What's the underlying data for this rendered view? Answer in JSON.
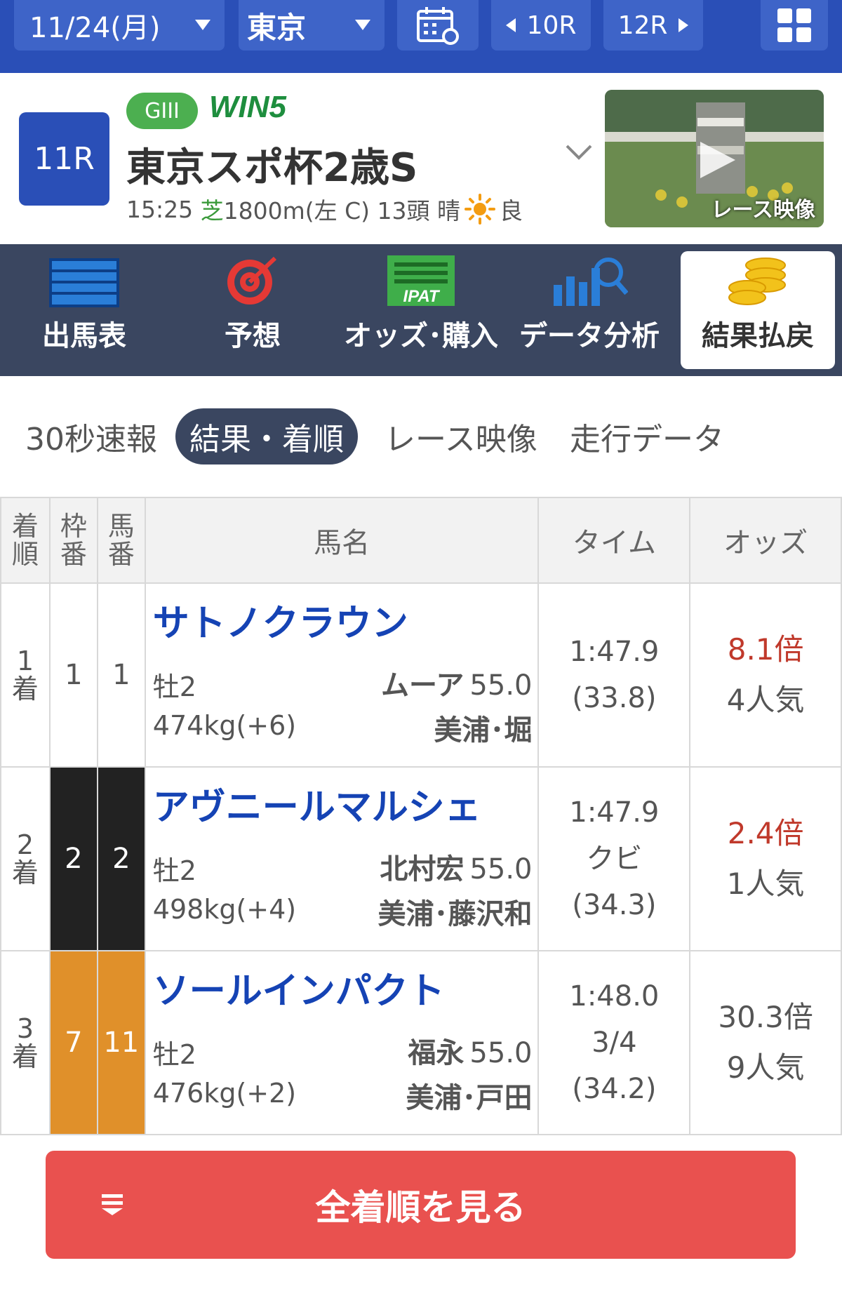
{
  "topbar": {
    "date": "11/24(月)",
    "venue": "東京",
    "prev_race": "10R",
    "next_race": "12R"
  },
  "race": {
    "number": "11R",
    "grade": "GIII",
    "win5_label": "WIN5",
    "title": "東京スポ杯2歳S",
    "time": "15:25",
    "surface": "芝",
    "distance": "1800m(左 C)",
    "runners": "13頭",
    "weather": "晴",
    "going": "良",
    "video_label": "レース映像"
  },
  "main_tabs": [
    "出馬表",
    "予想",
    "オッズ･購入",
    "データ分析",
    "結果払戻"
  ],
  "sub_tabs": [
    "30秒速報",
    "結果・着順",
    "レース映像",
    "走行データ"
  ],
  "table": {
    "headers": {
      "position": "着順",
      "frame": "枠番",
      "number": "馬番",
      "horse": "馬名",
      "time": "タイム",
      "odds": "オッズ"
    },
    "rows": [
      {
        "position": "1",
        "position_suffix": "着",
        "frame": "1",
        "number": "1",
        "frame_color": "#ffffff",
        "frame_text_color": "#555555",
        "horse": "サトノクラウン",
        "sex_age": "牡2",
        "jockey": "ムーア",
        "jockey_weight": "55.0",
        "weight": "474kg(+6)",
        "trainer": "美浦･堀",
        "time": "1:47.9",
        "margin": "",
        "last3f": "(33.8)",
        "odds": "8.1倍",
        "popularity": "4人気",
        "odds_highlight": true
      },
      {
        "position": "2",
        "position_suffix": "着",
        "frame": "2",
        "number": "2",
        "frame_color": "#222222",
        "frame_text_color": "#ffffff",
        "horse": "アヴニールマルシェ",
        "sex_age": "牡2",
        "jockey": "北村宏",
        "jockey_weight": "55.0",
        "weight": "498kg(+4)",
        "trainer": "美浦･藤沢和",
        "time": "1:47.9",
        "margin": "クビ",
        "last3f": "(34.3)",
        "odds": "2.4倍",
        "popularity": "1人気",
        "odds_highlight": true
      },
      {
        "position": "3",
        "position_suffix": "着",
        "frame": "7",
        "number": "11",
        "frame_color": "#e0902a",
        "frame_text_color": "#ffffff",
        "horse": "ソールインパクト",
        "sex_age": "牡2",
        "jockey": "福永",
        "jockey_weight": "55.0",
        "weight": "476kg(+2)",
        "trainer": "美浦･戸田",
        "time": "1:48.0",
        "margin": "3/4",
        "last3f": "(34.2)",
        "odds": "30.3倍",
        "popularity": "9人気",
        "odds_highlight": false
      }
    ]
  },
  "all_results_label": "全着順を見る",
  "colors": {
    "brand_blue": "#2a4fb7",
    "tab_bar": "#3a4660",
    "grade_green": "#4caf50",
    "horse_link": "#1543b4",
    "odds_red": "#c0392b",
    "cta_red": "#e9514f"
  }
}
